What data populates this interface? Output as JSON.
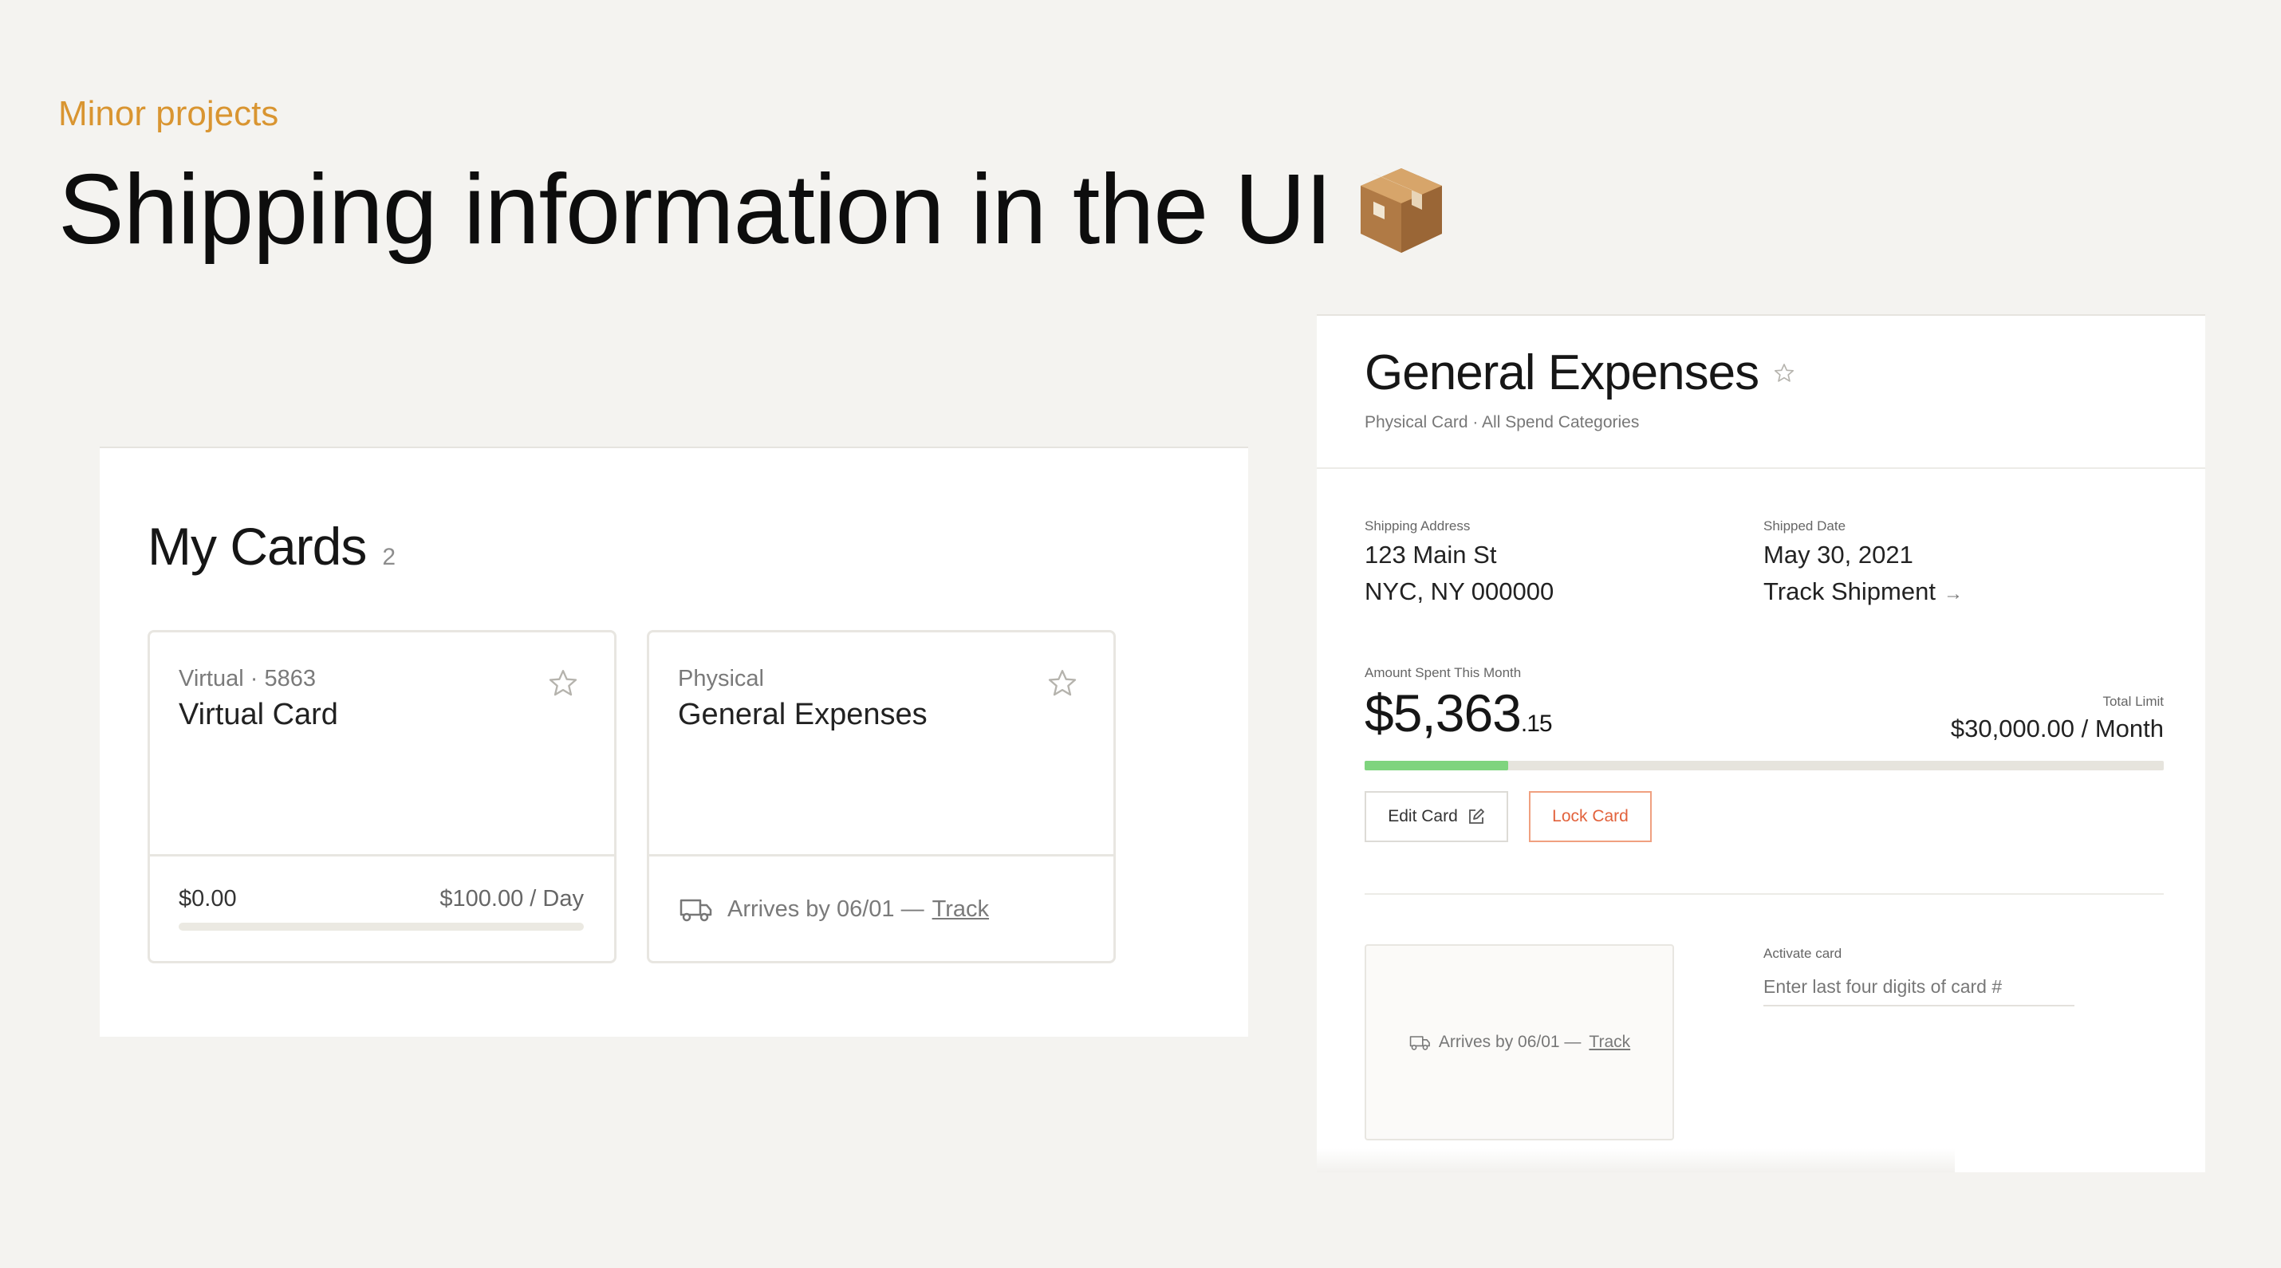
{
  "slide": {
    "eyebrow": "Minor projects",
    "headline": "Shipping information in the UI",
    "headline_icon": "package-icon"
  },
  "my_cards": {
    "title": "My Cards",
    "count": "2",
    "cards": [
      {
        "subtitle": "Virtual · 5863",
        "name": "Virtual Card",
        "icon": "star-icon",
        "balance": "$0.00",
        "limit": "$100.00 / Day",
        "spent_fraction": 0
      },
      {
        "subtitle": "Physical",
        "name": "General Expenses",
        "icon": "star-icon",
        "shipping_text": "Arrives by 06/01 —",
        "track_label": "Track",
        "shipping_icon": "truck-icon"
      }
    ]
  },
  "card_detail": {
    "title": "General Expenses",
    "subtitle": "Physical Card · All Spend Categories",
    "shipping_address_label": "Shipping Address",
    "address_line1": "123 Main St",
    "address_line2": "NYC, NY 000000",
    "shipped_date_label": "Shipped Date",
    "shipped_date": "May 30, 2021",
    "track_shipment_label": "Track Shipment",
    "track_arrow": "→",
    "amount_label": "Amount Spent This Month",
    "amount_main": "$5,363",
    "amount_cents": ".15",
    "total_limit_label": "Total Limit",
    "total_limit": "$30,000.00 / Month",
    "spent_fraction": 0.18,
    "edit_card_label": "Edit Card",
    "lock_card_label": "Lock Card",
    "shipping_box_text": "Arrives by 06/01 —",
    "shipping_box_track": "Track",
    "activate_label": "Activate card",
    "activate_placeholder": "Enter last four digits of card #",
    "colors": {
      "progress_fill": "#7fd47e",
      "lock_accent": "#e2623c",
      "eyebrow": "#d99531"
    }
  }
}
